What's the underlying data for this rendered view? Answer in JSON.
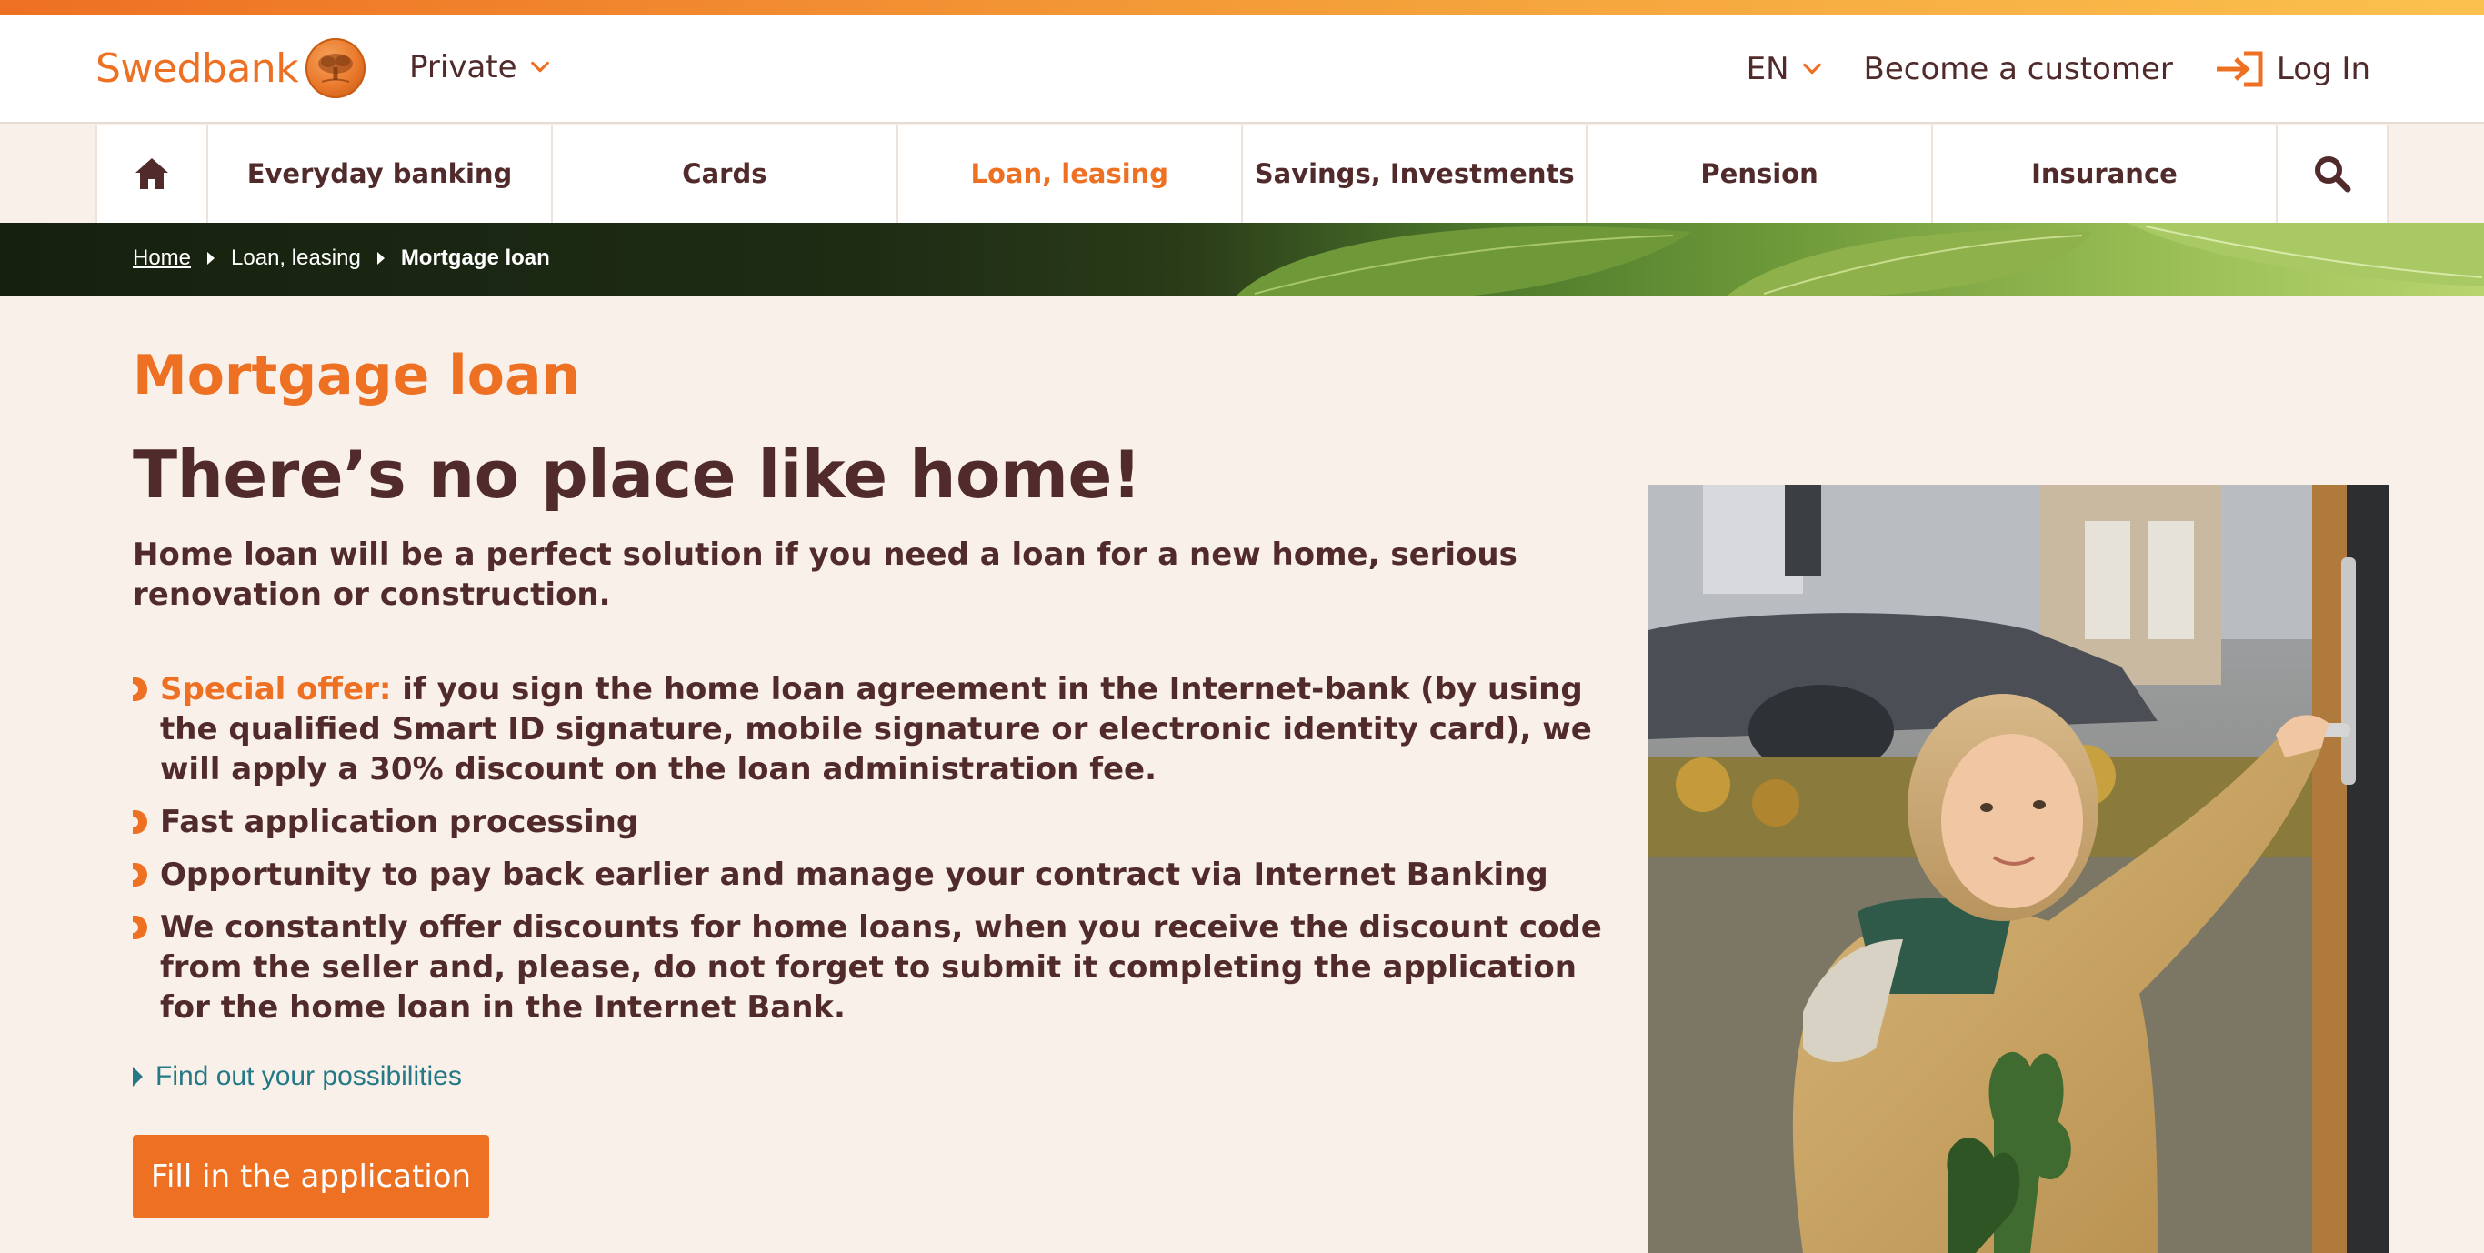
{
  "brand": {
    "name": "Swedbank",
    "accent": "#ee7023",
    "text_color": "#512b2b",
    "link_color": "#257886",
    "background": "#f8f0e9"
  },
  "header": {
    "segment": "Private",
    "language": "EN",
    "become_customer": "Become a customer",
    "login": "Log In"
  },
  "nav": {
    "home_icon": "home-icon",
    "items": [
      {
        "label": "Everyday banking",
        "active": false
      },
      {
        "label": "Cards",
        "active": false
      },
      {
        "label": "Loan, leasing",
        "active": true
      },
      {
        "label": "Savings, Investments",
        "active": false
      },
      {
        "label": "Pension",
        "active": false
      },
      {
        "label": "Insurance",
        "active": false
      }
    ],
    "search_icon": "search-icon"
  },
  "breadcrumb": {
    "home": "Home",
    "level2": "Loan, leasing",
    "current": "Mortgage loan"
  },
  "page": {
    "eyebrow": "Mortgage loan",
    "headline": "There’s no place like home!",
    "lead": "Home loan will be a perfect solution if you need a loan for a new home, serious renovation or construction.",
    "benefits": [
      {
        "highlight": "Special offer:",
        "text": " if you sign the home loan agreement in the Internet-bank (by using the qualified Smart ID signature, mobile signature or electronic identity card), we will apply a 30% discount on the loan administration fee."
      },
      {
        "highlight": "",
        "text": "Fast application processing"
      },
      {
        "highlight": "",
        "text": "Opportunity to pay back earlier and manage your contract via Internet Banking"
      },
      {
        "highlight": "",
        "text": "We constantly offer discounts for home loans, when you receive the discount code from the seller and, please, do not forget to submit it completing the application for the home loan in the Internet Bank."
      }
    ],
    "more_link": "Find out your possibilities",
    "cta": "Fill in the application"
  }
}
